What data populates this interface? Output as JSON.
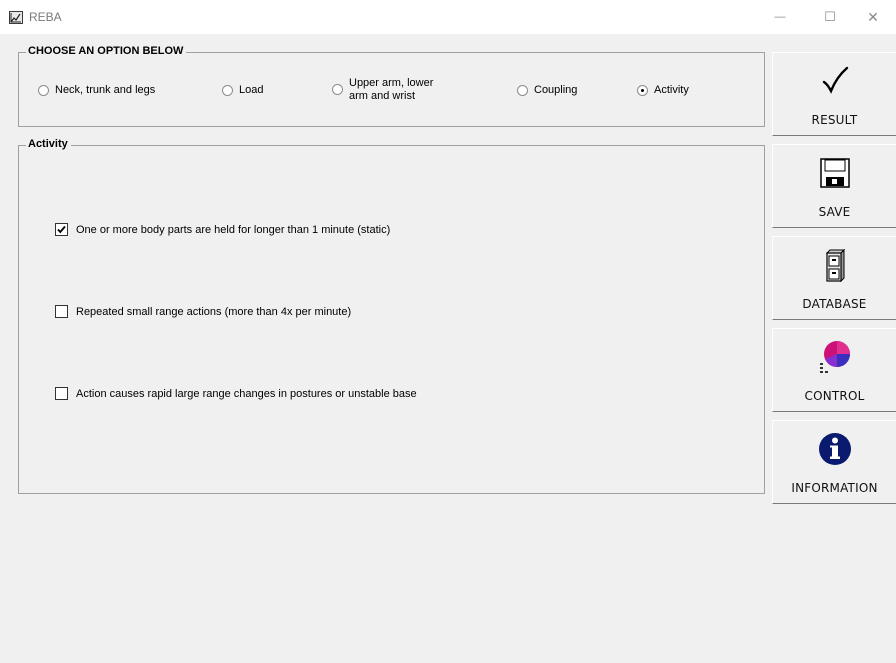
{
  "window": {
    "title": "REBA",
    "minimize_glyph": "—",
    "maximize_glyph": "☐",
    "close_glyph": "✕"
  },
  "options_group": {
    "title": "CHOOSE AN OPTION BELOW",
    "radios": [
      {
        "label": "Neck, trunk and legs",
        "checked": false
      },
      {
        "label": "Load",
        "checked": false
      },
      {
        "label_line1": "Upper arm, lower",
        "label_line2": "arm and wrist",
        "checked": false
      },
      {
        "label": "Coupling",
        "checked": false
      },
      {
        "label": "Activity",
        "checked": true
      }
    ]
  },
  "activity_group": {
    "title": "Activity",
    "checkboxes": [
      {
        "label": "One or more body parts are held for longer than 1 minute (static)",
        "checked": true
      },
      {
        "label": "Repeated small range actions (more than 4x per minute)",
        "checked": false
      },
      {
        "label": "Action causes rapid large range changes in postures or unstable base",
        "checked": false
      }
    ]
  },
  "side_buttons": [
    {
      "label": "RESULT",
      "icon": "checkmark-icon"
    },
    {
      "label": "SAVE",
      "icon": "floppy-disk-icon"
    },
    {
      "label": "DATABASE",
      "icon": "filing-cabinet-icon"
    },
    {
      "label": "CONTROL",
      "icon": "pie-chart-icon"
    },
    {
      "label": "INFORMATION",
      "icon": "info-icon"
    }
  ]
}
